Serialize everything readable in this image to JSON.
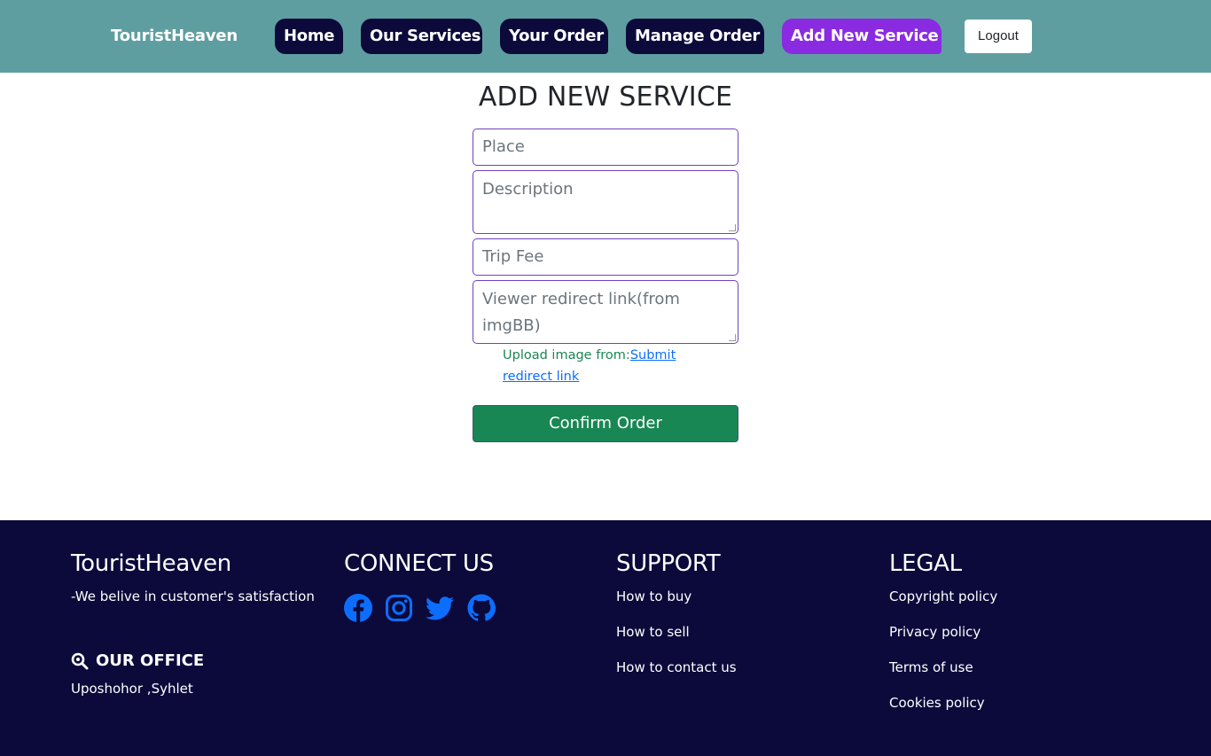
{
  "nav": {
    "brand": "TouristHeaven",
    "links": [
      "Home",
      "Our Services",
      "Your Order",
      "Manage Order",
      "Add New Service"
    ],
    "logout": "Logout",
    "active_color": "#8a2be2",
    "bg_color": "#5f9ea0"
  },
  "form": {
    "title": "ADD NEW SERVICE",
    "place_placeholder": "Place",
    "description_placeholder": "Description",
    "fee_placeholder": "Trip Fee",
    "link_placeholder": "Viewer redirect link(from imgBB)",
    "upload_prefix": "Upload image from:",
    "upload_link": "Submit redirect link",
    "submit": "Confirm Order"
  },
  "footer": {
    "brand": "TouristHeaven",
    "tagline": "-We belive in customer's satisfaction",
    "office_heading": "OUR OFFICE",
    "office_address": "Uposhohor ,Syhlet",
    "connect_heading": "CONNECT US",
    "social_icons": [
      "facebook-icon",
      "instagram-icon",
      "twitter-icon",
      "github-icon"
    ],
    "support_heading": "SUPPORT",
    "support_links": [
      "How to buy",
      "How to sell",
      "How to contact us"
    ],
    "legal_heading": "LEGAL",
    "legal_links": [
      "Copyright policy",
      "Privacy policy",
      "Terms of use",
      "Cookies policy"
    ],
    "bg_color": "#0b0a3b",
    "icon_color": "#0d6efd"
  }
}
